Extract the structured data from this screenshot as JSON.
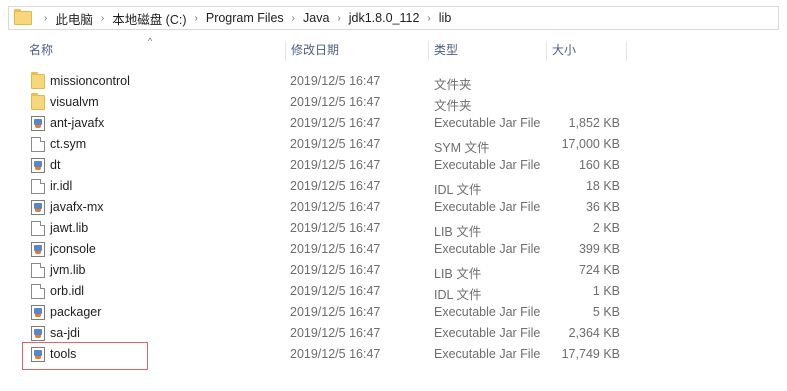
{
  "breadcrumb": [
    "此电脑",
    "本地磁盘 (C:)",
    "Program Files",
    "Java",
    "jdk1.8.0_112",
    "lib"
  ],
  "columns": {
    "name": "名称",
    "date": "修改日期",
    "type": "类型",
    "size": "大小"
  },
  "files": [
    {
      "name": "missioncontrol",
      "date": "2019/12/5 16:47",
      "type": "文件夹",
      "size": "",
      "icon": "folder-icon"
    },
    {
      "name": "visualvm",
      "date": "2019/12/5 16:47",
      "type": "文件夹",
      "size": "",
      "icon": "folder-icon"
    },
    {
      "name": "ant-javafx",
      "date": "2019/12/5 16:47",
      "type": "Executable Jar File",
      "size": "1,852 KB",
      "icon": "jar-file-icon"
    },
    {
      "name": "ct.sym",
      "date": "2019/12/5 16:47",
      "type": "SYM 文件",
      "size": "17,000 KB",
      "icon": "file-icon"
    },
    {
      "name": "dt",
      "date": "2019/12/5 16:47",
      "type": "Executable Jar File",
      "size": "160 KB",
      "icon": "jar-file-icon"
    },
    {
      "name": "ir.idl",
      "date": "2019/12/5 16:47",
      "type": "IDL 文件",
      "size": "18 KB",
      "icon": "file-icon"
    },
    {
      "name": "javafx-mx",
      "date": "2019/12/5 16:47",
      "type": "Executable Jar File",
      "size": "36 KB",
      "icon": "jar-file-icon"
    },
    {
      "name": "jawt.lib",
      "date": "2019/12/5 16:47",
      "type": "LIB 文件",
      "size": "2 KB",
      "icon": "file-icon"
    },
    {
      "name": "jconsole",
      "date": "2019/12/5 16:47",
      "type": "Executable Jar File",
      "size": "399 KB",
      "icon": "jar-file-icon"
    },
    {
      "name": "jvm.lib",
      "date": "2019/12/5 16:47",
      "type": "LIB 文件",
      "size": "724 KB",
      "icon": "file-icon"
    },
    {
      "name": "orb.idl",
      "date": "2019/12/5 16:47",
      "type": "IDL 文件",
      "size": "1 KB",
      "icon": "file-icon"
    },
    {
      "name": "packager",
      "date": "2019/12/5 16:47",
      "type": "Executable Jar File",
      "size": "5 KB",
      "icon": "jar-file-icon"
    },
    {
      "name": "sa-jdi",
      "date": "2019/12/5 16:47",
      "type": "Executable Jar File",
      "size": "2,364 KB",
      "icon": "jar-file-icon"
    },
    {
      "name": "tools",
      "date": "2019/12/5 16:47",
      "type": "Executable Jar File",
      "size": "17,749 KB",
      "icon": "jar-file-icon"
    }
  ],
  "highlight_color": "#e06666"
}
